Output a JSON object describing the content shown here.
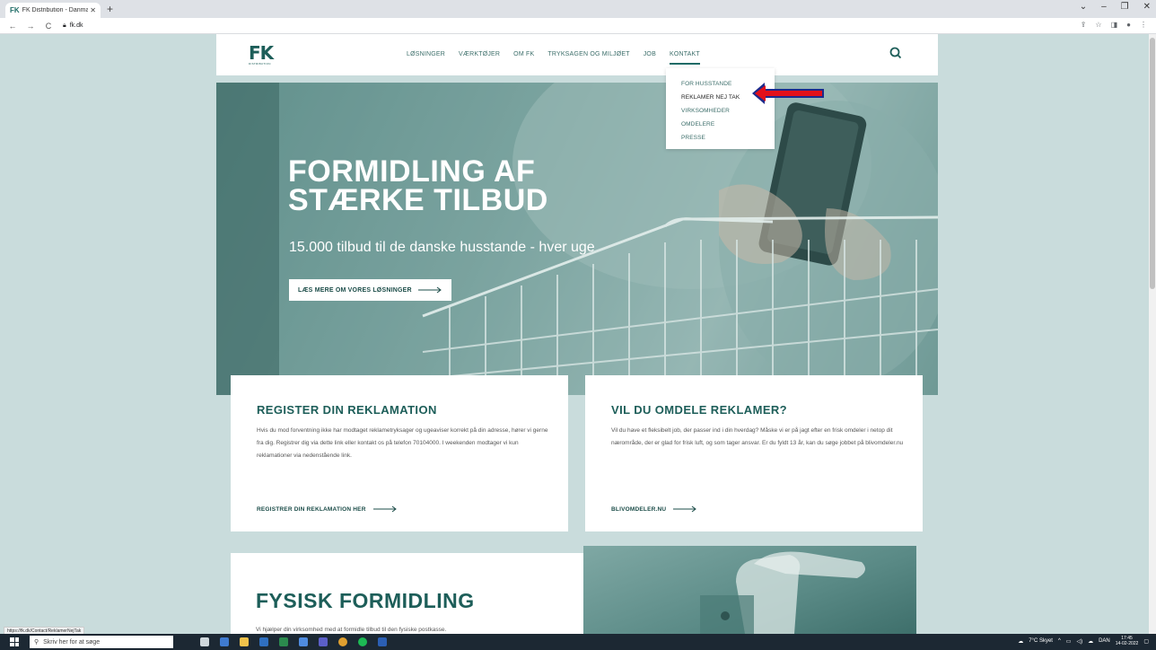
{
  "browser": {
    "tab_title": "FK Distribution - Danmarks stær...",
    "tab_favicon_text": "FK",
    "url": "fk.dk",
    "status_url": "https://fk.dk/Contact/ReklamerNejTak"
  },
  "site": {
    "logo_text": "FK",
    "logo_subtext": "DISTRIBUTION",
    "nav": [
      "LØSNINGER",
      "VÆRKTØJER",
      "OM FK",
      "TRYKSAGEN OG MILJØET",
      "JOB",
      "KONTAKT"
    ],
    "active_nav": "KONTAKT",
    "dropdown": [
      "FOR HUSSTANDE",
      "REKLAMER NEJ TAK",
      "VIRKSOMHEDER",
      "OMDELERE",
      "PRESSE"
    ]
  },
  "hero": {
    "title_line1": "FORMIDLING AF",
    "title_line2": "STÆRKE TILBUD",
    "subtitle": "15.000 tilbud til de danske husstande - hver uge",
    "button": "LÆS MERE OM VORES LØSNINGER"
  },
  "card_reklamation": {
    "title": "REGISTER DIN REKLAMATION",
    "body": "Hvis du mod forventning ikke har modtaget reklametryksager og ugeaviser korrekt på din adresse, hører vi gerne fra dig. Registrer dig via dette link eller kontakt os på telefon 70104000. I weekenden modtager vi kun reklamationer via nedenstående link.",
    "link": "REGISTRER DIN REKLAMATION HER"
  },
  "card_omdele": {
    "title": "VIL DU OMDELE REKLAMER?",
    "body": "Vil du have et fleksibelt job, der passer ind i din hverdag? Måske vi er på jagt efter en frisk omdeler i netop dit nærområde, der er glad for frisk luft, og som tager ansvar. Er du fyldt 13 år, kan du søge jobbet på blivomdeler.nu",
    "link": "BLIVOMDELER.NU"
  },
  "card_fysisk": {
    "title": "FYSISK FORMIDLING",
    "body": "Vi hjælper din virksomhed med at formidle tilbud til den fysiske postkasse."
  },
  "taskbar": {
    "search_placeholder": "Skriv her for at søge",
    "weather": "7°C Skyet",
    "language": "DAN",
    "time": "17:45",
    "date": "14-02-2022"
  },
  "colors": {
    "brand": "#1d5e59",
    "background": "#c9dcdc",
    "arrow": "#e3101a"
  }
}
